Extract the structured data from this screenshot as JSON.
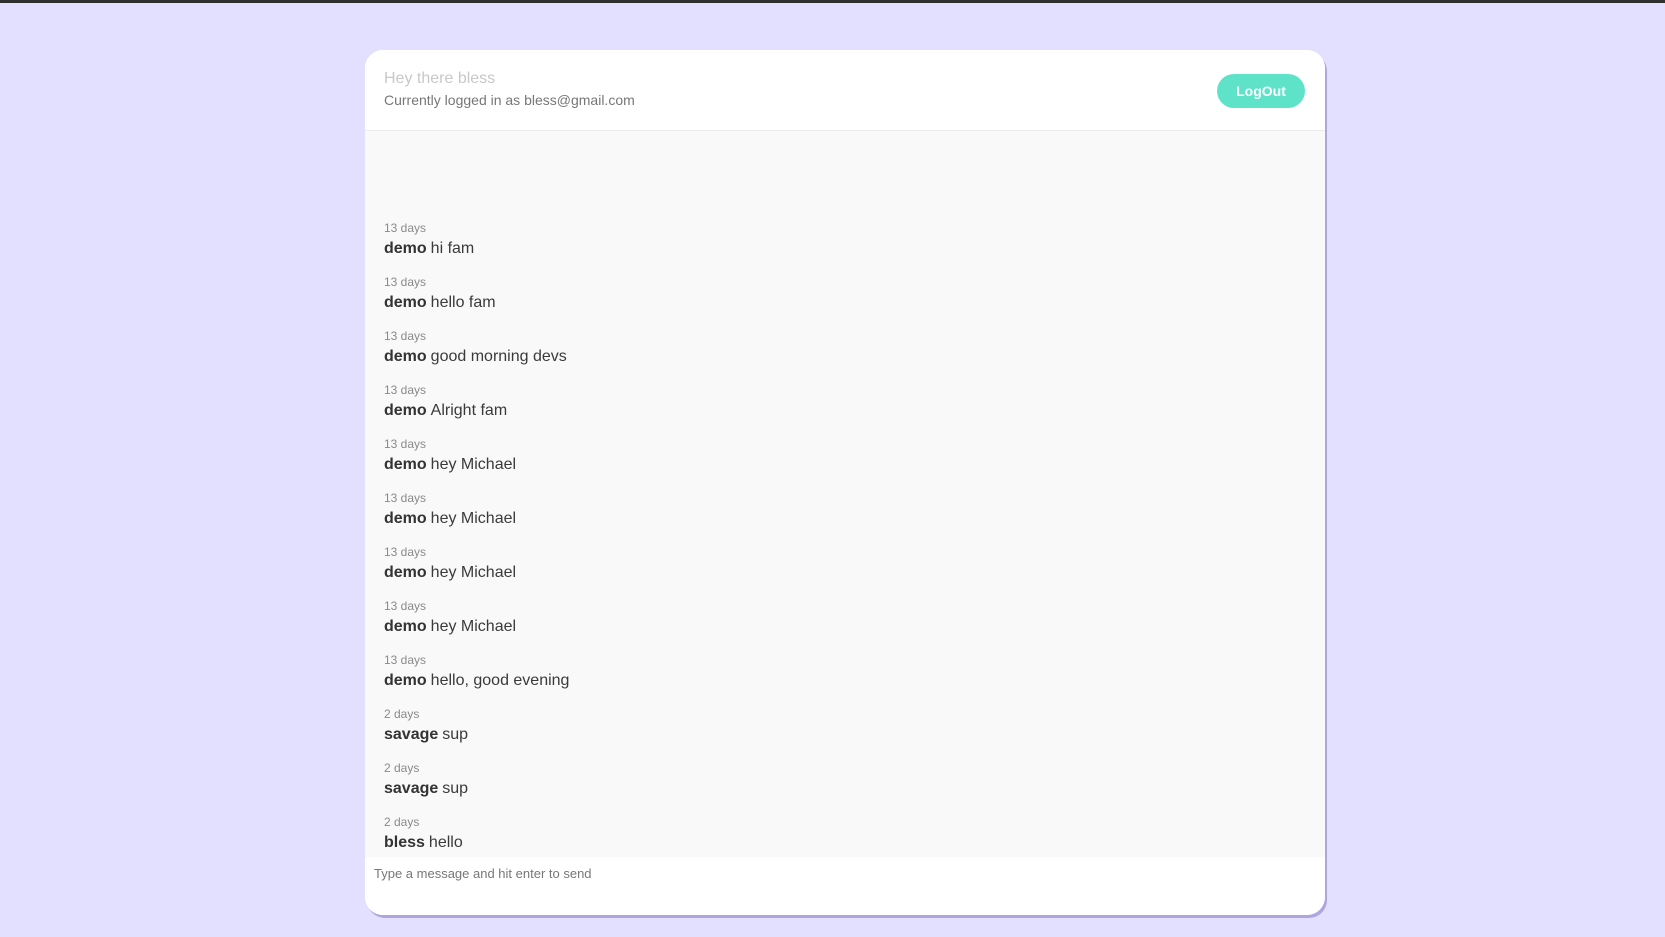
{
  "header": {
    "greeting": "Hey there bless",
    "status": "Currently logged in as bless@gmail.com",
    "logout_label": "LogOut"
  },
  "messages": [
    {
      "time": "13 days",
      "user": "demo",
      "text": "hi fam"
    },
    {
      "time": "13 days",
      "user": "demo",
      "text": "hello fam"
    },
    {
      "time": "13 days",
      "user": "demo",
      "text": "good morning devs"
    },
    {
      "time": "13 days",
      "user": "demo",
      "text": "Alright fam"
    },
    {
      "time": "13 days",
      "user": "demo",
      "text": "hey Michael"
    },
    {
      "time": "13 days",
      "user": "demo",
      "text": "hey Michael"
    },
    {
      "time": "13 days",
      "user": "demo",
      "text": "hey Michael"
    },
    {
      "time": "13 days",
      "user": "demo",
      "text": "hey Michael"
    },
    {
      "time": "13 days",
      "user": "demo",
      "text": "hello, good evening"
    },
    {
      "time": "2 days",
      "user": "savage",
      "text": "sup"
    },
    {
      "time": "2 days",
      "user": "savage",
      "text": "sup"
    },
    {
      "time": "2 days",
      "user": "bless",
      "text": "hello"
    }
  ],
  "composer": {
    "placeholder": "Type a message and hit enter to send",
    "value": ""
  },
  "colors": {
    "background": "#e2dfff",
    "accent": "#5ee2c8"
  }
}
